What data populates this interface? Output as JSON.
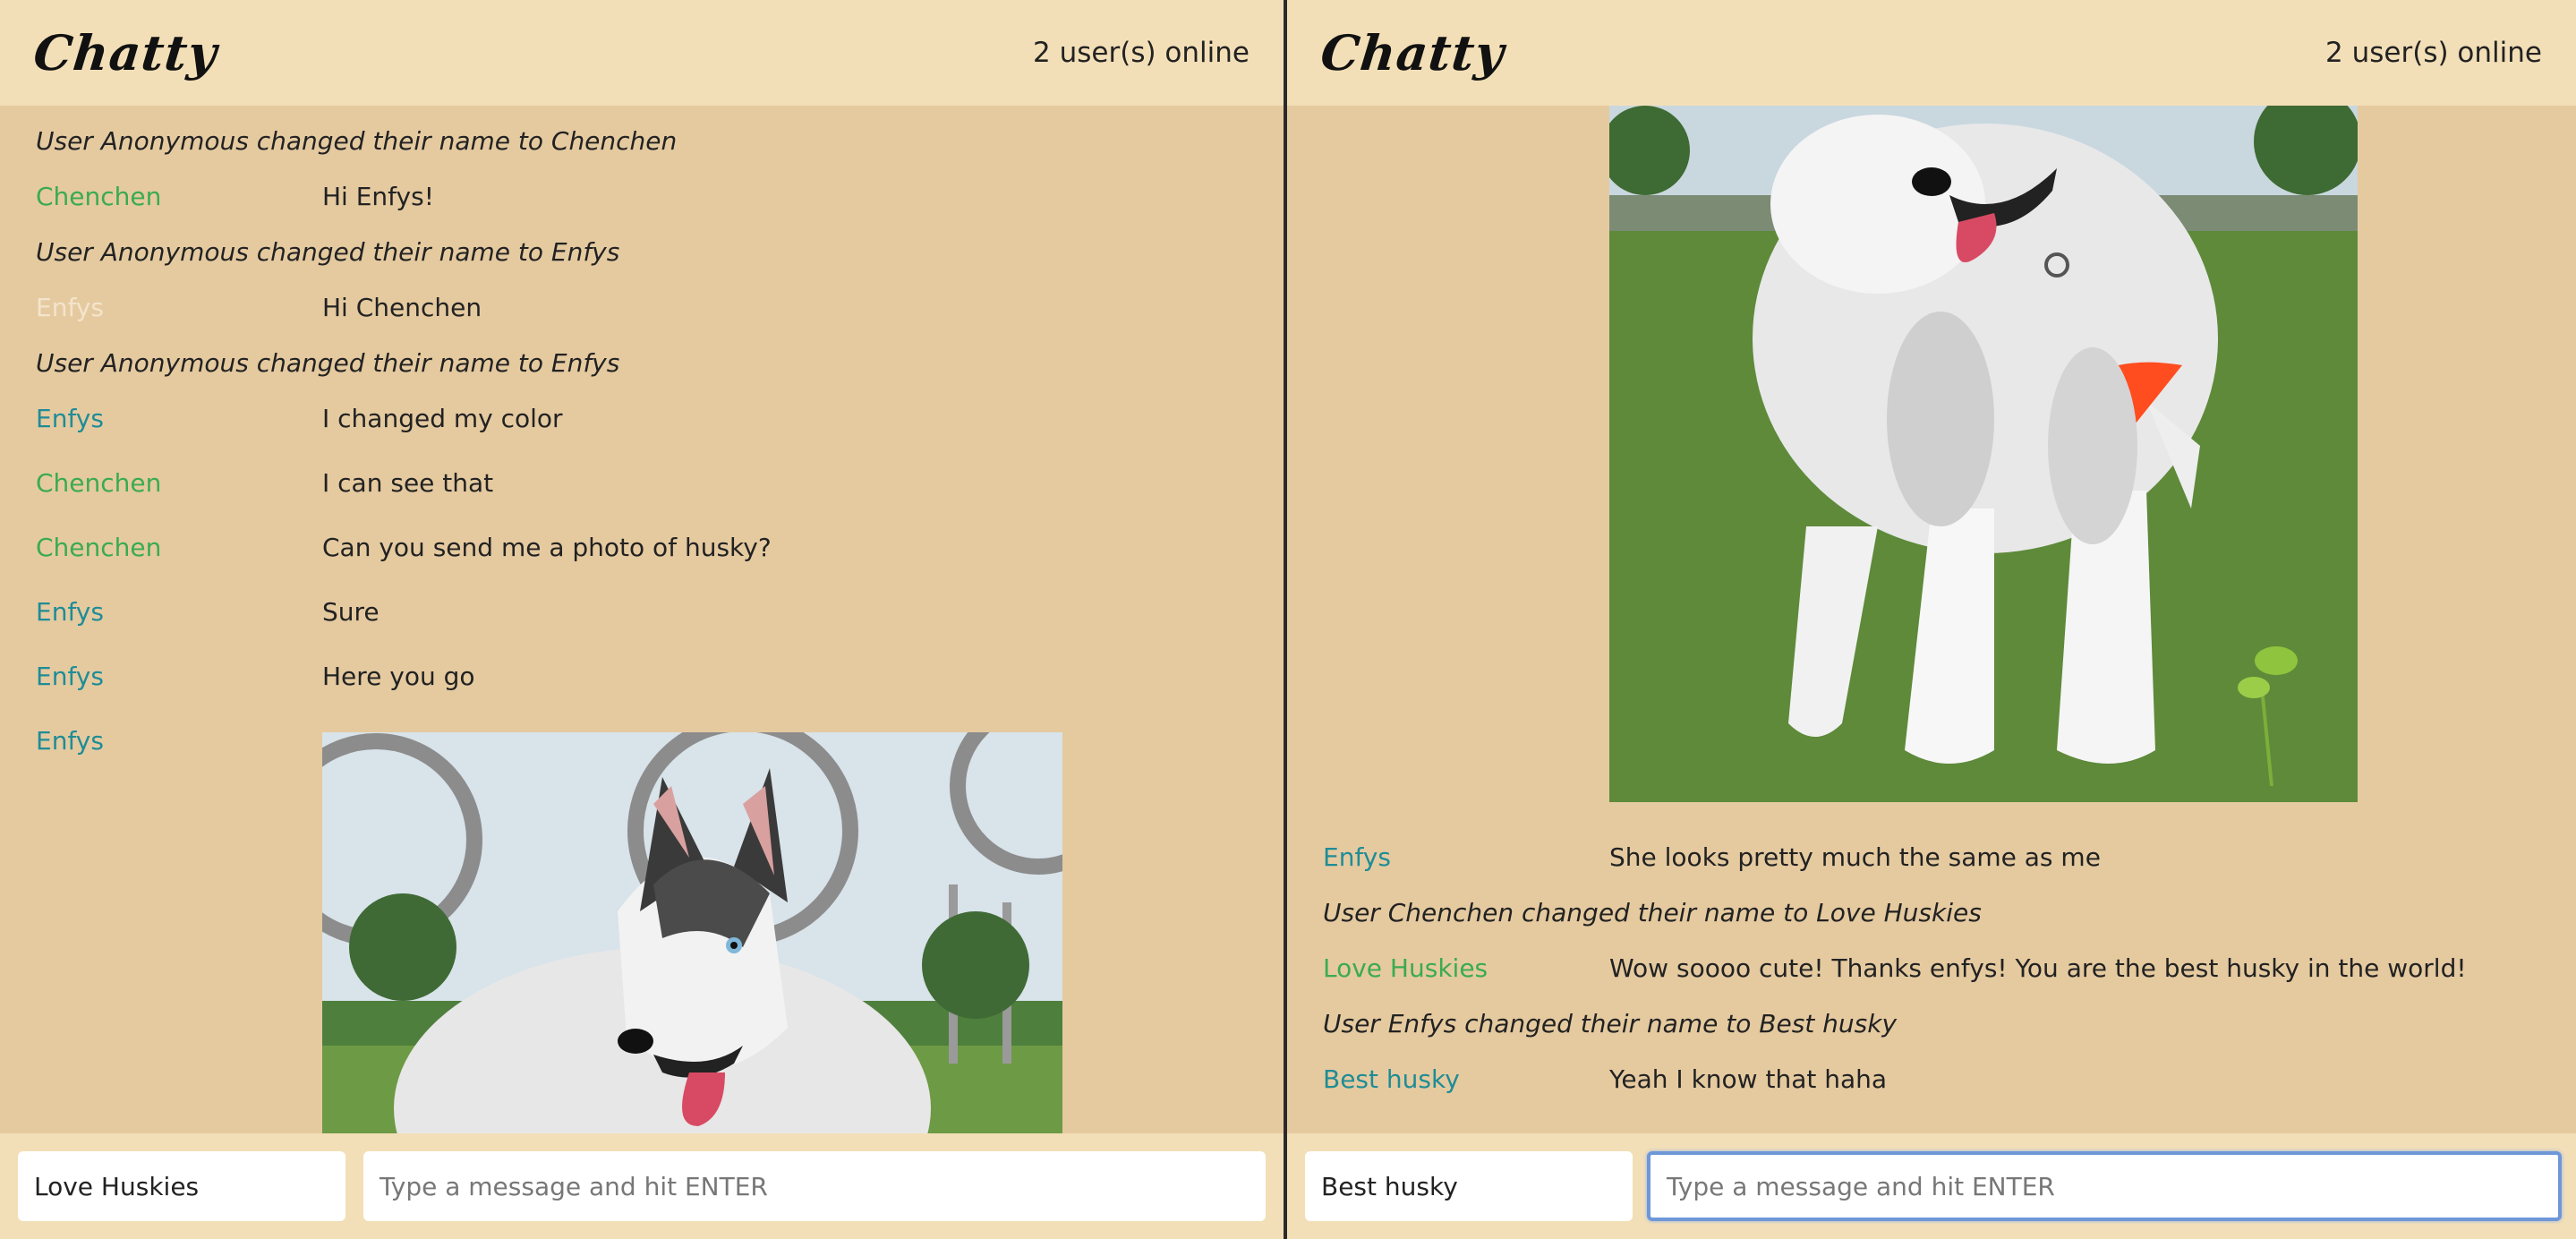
{
  "left": {
    "header": {
      "logo": "Chatty",
      "online": "2 user(s) online"
    },
    "messages": [
      {
        "kind": "notice",
        "text": "User Anonymous changed their name to Chenchen"
      },
      {
        "kind": "msg",
        "user": "Chenchen",
        "color": "#3bab4f",
        "text": "Hi Enfys!"
      },
      {
        "kind": "notice",
        "text": "User Anonymous changed their name to Enfys"
      },
      {
        "kind": "msg",
        "user": "Enfys",
        "color": "#f4e4cc",
        "text": "Hi Chenchen"
      },
      {
        "kind": "notice",
        "text": "User Anonymous changed their name to Enfys"
      },
      {
        "kind": "msg",
        "user": "Enfys",
        "color": "#1f8c96",
        "text": "I changed my color"
      },
      {
        "kind": "msg",
        "user": "Chenchen",
        "color": "#3bab4f",
        "text": "I can see that"
      },
      {
        "kind": "msg",
        "user": "Chenchen",
        "color": "#3bab4f",
        "text": "Can you send me a photo of husky?"
      },
      {
        "kind": "msg",
        "user": "Enfys",
        "color": "#1f8c96",
        "text": "Sure"
      },
      {
        "kind": "msg",
        "user": "Enfys",
        "color": "#1f8c96",
        "text": "Here you go"
      },
      {
        "kind": "image",
        "user": "Enfys",
        "color": "#1f8c96",
        "image": "husky-photo"
      }
    ],
    "footer": {
      "name_value": "Love Huskies",
      "message_placeholder": "Type a message and hit ENTER"
    }
  },
  "right": {
    "header": {
      "logo": "Chatty",
      "online": "2 user(s) online"
    },
    "messages": [
      {
        "kind": "image",
        "user": "",
        "color": "#1f8c96",
        "image": "husky-photo"
      },
      {
        "kind": "msg",
        "user": "Enfys",
        "color": "#1f8c96",
        "text": "She looks pretty much the same as me"
      },
      {
        "kind": "notice",
        "text": "User Chenchen changed their name to Love Huskies"
      },
      {
        "kind": "msg",
        "user": "Love Huskies",
        "color": "#3bab4f",
        "text": "Wow soooo cute! Thanks enfys! You are the best husky in the world!"
      },
      {
        "kind": "notice",
        "text": "User Enfys changed their name to Best husky"
      },
      {
        "kind": "msg",
        "user": "Best husky",
        "color": "#1f8c96",
        "text": "Yeah I know that haha"
      }
    ],
    "footer": {
      "name_value": "Best husky",
      "message_placeholder": "Type a message and hit ENTER"
    }
  }
}
